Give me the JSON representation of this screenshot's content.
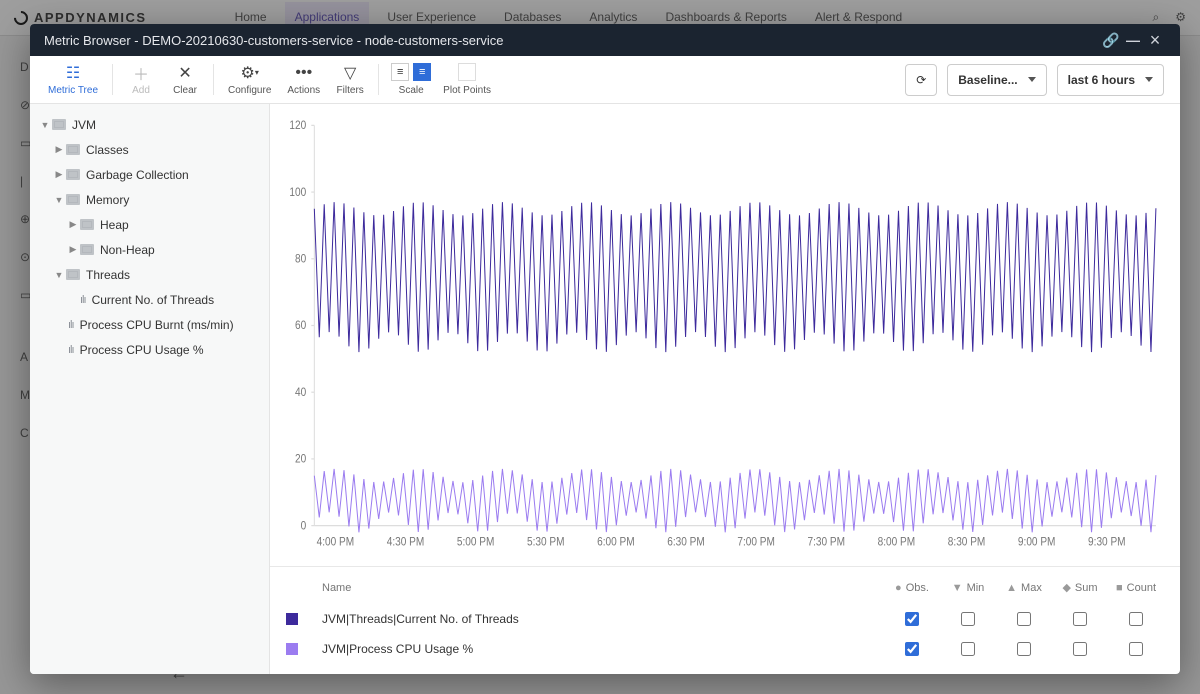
{
  "bg": {
    "brand": "APPDYNAMICS",
    "nav": {
      "home": "Home",
      "applications": "Applications",
      "ux": "User Experience",
      "databases": "Databases",
      "analytics": "Analytics",
      "dashboards": "Dashboards & Reports",
      "alert": "Alert & Respond"
    }
  },
  "modal": {
    "title": "Metric Browser - DEMO-20210630-customers-service - node-customers-service"
  },
  "toolbar": {
    "metric_tree": "Metric Tree",
    "add": "Add",
    "clear": "Clear",
    "configure": "Configure",
    "actions": "Actions",
    "filters": "Filters",
    "scale": "Scale",
    "plot_points": "Plot Points",
    "baseline": "Baseline...",
    "time_range": "last 6 hours"
  },
  "tree": {
    "jvm": "JVM",
    "classes": "Classes",
    "gc": "Garbage Collection",
    "memory": "Memory",
    "heap": "Heap",
    "nonheap": "Non-Heap",
    "threads": "Threads",
    "threads_current": "Current No. of Threads",
    "cpu_burnt": "Process CPU Burnt (ms/min)",
    "cpu_usage": "Process CPU Usage %"
  },
  "legend": {
    "name": "Name",
    "obs": "Obs.",
    "min": "Min",
    "max": "Max",
    "sum": "Sum",
    "count": "Count",
    "row1": "JVM|Threads|Current No. of Threads",
    "row2": "JVM|Process CPU Usage %"
  },
  "chart_data": {
    "type": "line",
    "ylim": [
      0,
      120
    ],
    "yticks": [
      0,
      20,
      40,
      60,
      80,
      100,
      120
    ],
    "xlabels": [
      "4:00 PM",
      "4:30 PM",
      "5:00 PM",
      "5:30 PM",
      "6:00 PM",
      "6:30 PM",
      "7:00 PM",
      "7:30 PM",
      "8:00 PM",
      "8:30 PM",
      "9:00 PM",
      "9:30 PM"
    ],
    "series": [
      {
        "name": "JVM|Threads|Current No. of Threads",
        "color": "#3d2a9c",
        "low": 55,
        "high": 95,
        "oscillations": 85
      },
      {
        "name": "JVM|Process CPU Usage %",
        "color": "#9b7cf0",
        "low": 1,
        "high": 15,
        "oscillations": 85
      }
    ]
  }
}
